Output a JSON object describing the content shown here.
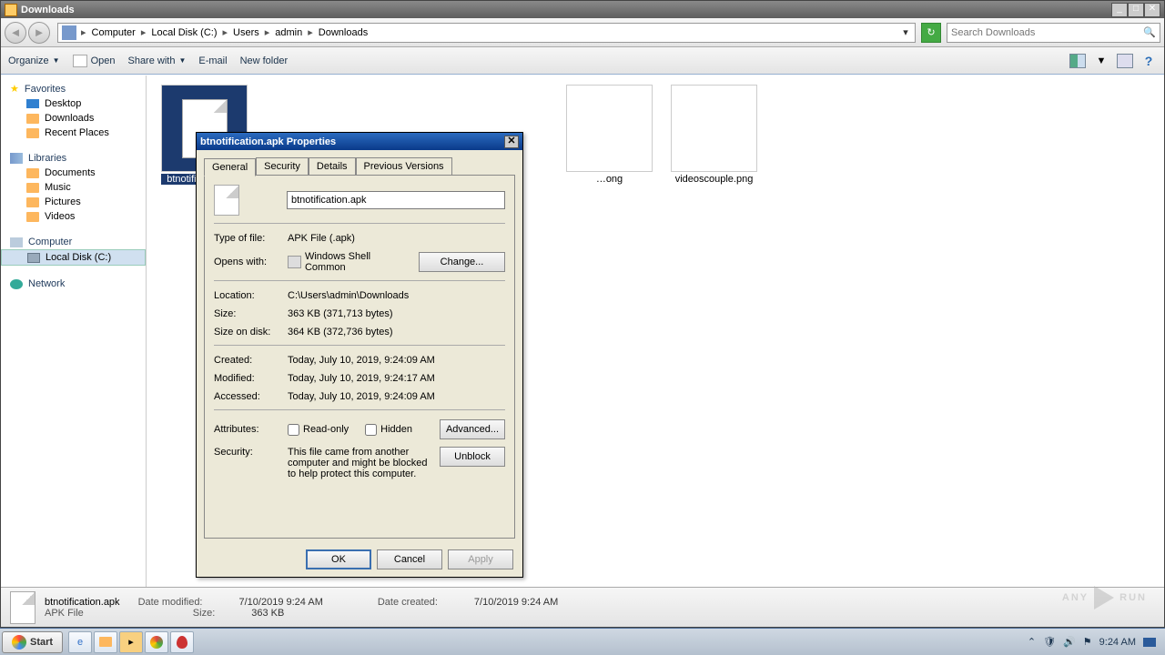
{
  "window": {
    "title": "Downloads",
    "controls": {
      "min": "_",
      "max": "□",
      "close": "✕"
    }
  },
  "breadcrumb": {
    "parts": [
      "Computer",
      "Local Disk (C:)",
      "Users",
      "admin",
      "Downloads"
    ]
  },
  "search": {
    "placeholder": "Search Downloads"
  },
  "toolbar": {
    "organize": "Organize",
    "open": "Open",
    "share": "Share with",
    "email": "E-mail",
    "newfolder": "New folder"
  },
  "sidebar": {
    "favorites": {
      "label": "Favorites",
      "items": [
        "Desktop",
        "Downloads",
        "Recent Places"
      ]
    },
    "libraries": {
      "label": "Libraries",
      "items": [
        "Documents",
        "Music",
        "Pictures",
        "Videos"
      ]
    },
    "computer": {
      "label": "Computer",
      "items": [
        "Local Disk (C:)"
      ]
    },
    "network": {
      "label": "Network"
    }
  },
  "files": [
    {
      "name": "btnotification.apk",
      "selected": true
    },
    {
      "name": "…ong",
      "selected": false
    },
    {
      "name": "videoscouple.png",
      "selected": false
    }
  ],
  "statusbar": {
    "name": "btnotification.apk",
    "type": "APK File",
    "modified_label": "Date modified:",
    "modified": "7/10/2019 9:24 AM",
    "created_label": "Date created:",
    "created": "7/10/2019 9:24 AM",
    "size_label": "Size:",
    "size": "363 KB"
  },
  "dialog": {
    "title": "btnotification.apk Properties",
    "tabs": [
      "General",
      "Security",
      "Details",
      "Previous Versions"
    ],
    "filename": "btnotification.apk",
    "rows": {
      "typeoffile_label": "Type of file:",
      "typeoffile": "APK File (.apk)",
      "openswith_label": "Opens with:",
      "openswith": "Windows Shell Common",
      "change_btn": "Change...",
      "location_label": "Location:",
      "location": "C:\\Users\\admin\\Downloads",
      "size_label": "Size:",
      "size": "363 KB (371,713 bytes)",
      "sizeondisk_label": "Size on disk:",
      "sizeondisk": "364 KB (372,736 bytes)",
      "created_label": "Created:",
      "created": "Today, July 10, 2019, 9:24:09 AM",
      "modified_label": "Modified:",
      "modified": "Today, July 10, 2019, 9:24:17 AM",
      "accessed_label": "Accessed:",
      "accessed": "Today, July 10, 2019, 9:24:09 AM",
      "attributes_label": "Attributes:",
      "readonly": "Read-only",
      "hidden": "Hidden",
      "advanced_btn": "Advanced...",
      "security_label": "Security:",
      "security_text": "This file came from another computer and might be blocked to help protect this computer.",
      "unblock_btn": "Unblock"
    },
    "footer": {
      "ok": "OK",
      "cancel": "Cancel",
      "apply": "Apply"
    }
  },
  "taskbar": {
    "start": "Start",
    "clock": "9:24 AM"
  },
  "watermark": {
    "a": "ANY",
    "b": "RUN"
  }
}
